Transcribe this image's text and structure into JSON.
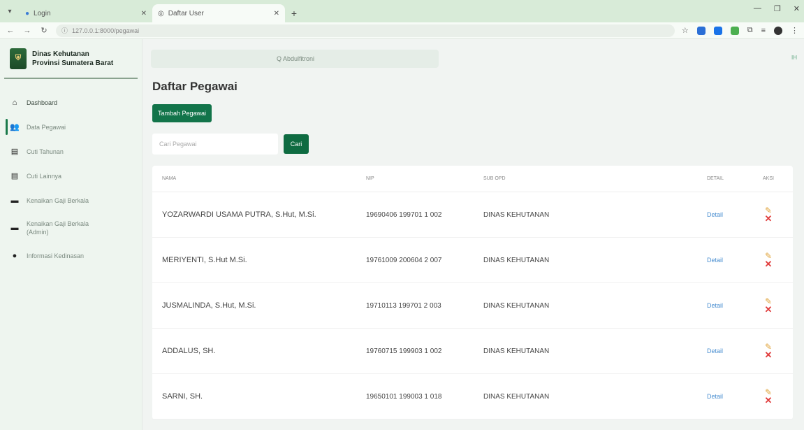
{
  "browser": {
    "tabs": [
      {
        "title": "Login"
      },
      {
        "title": "Daftar User"
      }
    ],
    "url": "127.0.0.1:8000/pegawai"
  },
  "brand": {
    "line1": "Dinas Kehutanan",
    "line2": "Provinsi Sumatera Barat"
  },
  "search": {
    "placeholder": "Q  Abdulfitroni"
  },
  "sidebar": {
    "items": [
      {
        "label": "Dashboard"
      },
      {
        "label": "Data Pegawai"
      },
      {
        "label": "Cuti Tahunan"
      },
      {
        "label": "Cuti Lainnya"
      },
      {
        "label": "Kenaikan Gaji Berkala"
      },
      {
        "label": "Kenaikan Gaji Berkala (Admin)"
      },
      {
        "label": "Informasi Kedinasan"
      }
    ]
  },
  "page": {
    "title": "Daftar Pegawai",
    "add_button": "Tambah Pegawai",
    "search_placeholder": "Cari Pegawai",
    "search_button": "Cari"
  },
  "table": {
    "headers": [
      "NAMA",
      "NIP",
      "SUB OPD",
      "DETAIL",
      "AKSI"
    ],
    "rows": [
      {
        "nama": "YOZARWARDI USAMA PUTRA, S.Hut, M.Si.",
        "nip": "19690406 199701 1 002",
        "sub": "DINAS KEHUTANAN",
        "detail": "Detail"
      },
      {
        "nama": "MERIYENTI, S.Hut M.Si.",
        "nip": "19761009 200604 2 007",
        "sub": "DINAS KEHUTANAN",
        "detail": "Detail"
      },
      {
        "nama": "JUSMALINDA, S.Hut, M.Si.",
        "nip": "19710113 199701 2 003",
        "sub": "DINAS KEHUTANAN",
        "detail": "Detail"
      },
      {
        "nama": "ADDALUS, SH.",
        "nip": "19760715 199903 1 002",
        "sub": "DINAS KEHUTANAN",
        "detail": "Detail"
      },
      {
        "nama": "SARNI, SH.",
        "nip": "19650101 199003 1 018",
        "sub": "DINAS KEHUTANAN",
        "detail": "Detail"
      }
    ]
  }
}
